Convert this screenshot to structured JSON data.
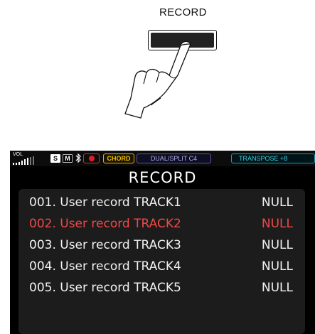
{
  "illustration": {
    "button_label": "RECORD"
  },
  "statusbar": {
    "vol_label": "VOL",
    "s_label": "S",
    "m_label": "M",
    "chord_label": "CHORD",
    "dual_split_label": "DUAL/SPLIT C4",
    "transpose_label": "TRANSPOSE +8"
  },
  "screen": {
    "title": "RECORD",
    "selected_index": 1,
    "tracks": [
      {
        "name": "001. User record TRACK1",
        "value": "NULL"
      },
      {
        "name": "002. User record TRACK2",
        "value": "NULL"
      },
      {
        "name": "003. User record TRACK3",
        "value": "NULL"
      },
      {
        "name": "004. User record TRACK4",
        "value": "NULL"
      },
      {
        "name": "005. User record TRACK5",
        "value": "NULL"
      }
    ]
  },
  "colors": {
    "selected_text": "#f04848",
    "list_background": "#1c1c1c",
    "chord_accent": "#f0c000",
    "transpose_accent": "#40d0e0"
  }
}
